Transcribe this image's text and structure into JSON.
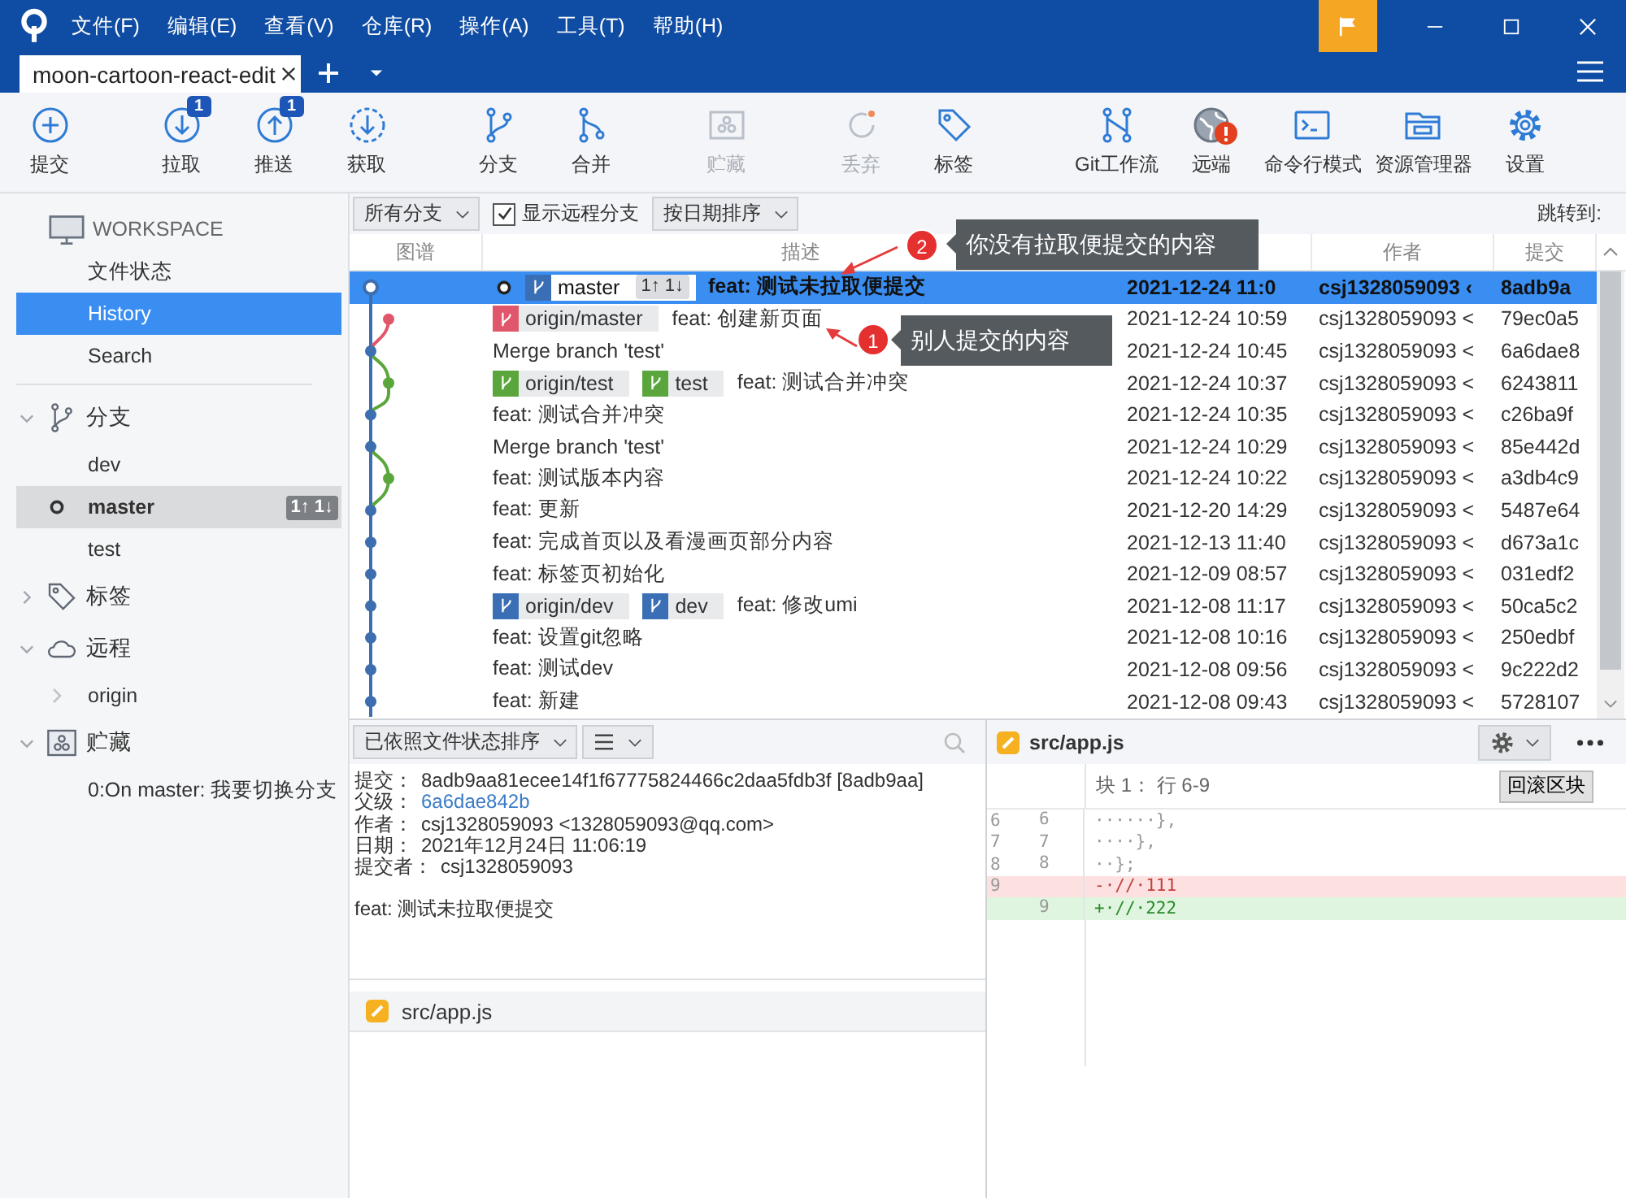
{
  "title_bar": {
    "menus": [
      "文件(F)",
      "编辑(E)",
      "查看(V)",
      "仓库(R)",
      "操作(A)",
      "工具(T)",
      "帮助(H)"
    ]
  },
  "tabs": [
    {
      "label": "moon-cartoon-react-edit",
      "selected": true
    }
  ],
  "toolbar": {
    "groups": [
      [
        {
          "label": "提交",
          "kind": "commit",
          "disabled": false
        }
      ],
      [
        {
          "label": "拉取",
          "kind": "pull",
          "disabled": false,
          "badge": "1"
        },
        {
          "label": "推送",
          "kind": "push",
          "disabled": false,
          "badge": "1"
        },
        {
          "label": "获取",
          "kind": "fetch",
          "disabled": false
        }
      ],
      [
        {
          "label": "分支",
          "kind": "branch",
          "disabled": false
        },
        {
          "label": "合并",
          "kind": "merge",
          "disabled": false
        }
      ],
      [
        {
          "label": "贮藏",
          "kind": "stash",
          "disabled": true
        }
      ],
      [
        {
          "label": "丢弃",
          "kind": "discard",
          "disabled": true
        },
        {
          "label": "标签",
          "kind": "tag",
          "disabled": false
        }
      ],
      [
        {
          "label": "Git工作流",
          "kind": "flow",
          "disabled": false
        },
        {
          "label": "远端",
          "kind": "remote",
          "disabled": false,
          "warning": true
        },
        {
          "label": "命令行模式",
          "kind": "terminal",
          "disabled": false
        },
        {
          "label": "资源管理器",
          "kind": "explorer",
          "disabled": false
        },
        {
          "label": "设置",
          "kind": "settings",
          "disabled": false
        }
      ]
    ]
  },
  "sidebar": {
    "workspace": {
      "title": "WORKSPACE",
      "items": [
        {
          "label": "文件状态",
          "selected": false
        },
        {
          "label": "History",
          "selected": true
        },
        {
          "label": "Search",
          "selected": false
        }
      ]
    },
    "sections": [
      {
        "title": "分支",
        "kind": "branches",
        "expanded": true,
        "items": [
          {
            "label": "dev",
            "current": false,
            "selected": false
          },
          {
            "label": "master",
            "current": true,
            "selected": true,
            "sync": "1↑ 1↓"
          },
          {
            "label": "test",
            "current": false,
            "selected": false
          }
        ]
      },
      {
        "title": "标签",
        "kind": "tags",
        "expanded": false
      },
      {
        "title": "远程",
        "kind": "remotes",
        "expanded": true,
        "items": [
          {
            "label": "origin",
            "expandable": true,
            "current": false,
            "selected": false
          }
        ]
      },
      {
        "title": "贮藏",
        "kind": "stashes",
        "expanded": true,
        "items": [
          {
            "label": "0:On master: 我要切换分支",
            "current": false,
            "selected": false
          }
        ]
      }
    ]
  },
  "filter_bar": {
    "branch_filter": "所有分支",
    "show_remote": {
      "label": "显示远程分支",
      "checked": true
    },
    "sort": "按日期排序",
    "jump_label": "跳转到:"
  },
  "table": {
    "columns": {
      "graph": "图谱",
      "description": "描述",
      "author": "作者",
      "commit": "提交"
    },
    "rows": [
      {
        "selected": true,
        "head": true,
        "refs": [
          {
            "label": "master",
            "color": "#3b6fb5",
            "sync": "1↑ 1↓"
          }
        ],
        "message": "feat: 测试未拉取便提交",
        "date": "2021-12-24 11:0",
        "author": "csj1328059093 ‹",
        "hash": "8adb9a"
      },
      {
        "selected": false,
        "head": false,
        "refs": [
          {
            "label": "origin/master",
            "color": "#e0566a"
          }
        ],
        "message": "feat: 创建新页面",
        "date": "2021-12-24 10:59",
        "author": "csj1328059093 <",
        "hash": "79ec0a5"
      },
      {
        "selected": false,
        "head": false,
        "message": "Merge branch 'test'",
        "date": "2021-12-24 10:45",
        "author": "csj1328059093 <",
        "hash": "6a6dae8"
      },
      {
        "selected": false,
        "head": false,
        "refs": [
          {
            "label": "origin/test",
            "color": "#5ba63c"
          },
          {
            "label": "test",
            "color": "#5ba63c"
          }
        ],
        "message": "feat: 测试合并冲突",
        "date": "2021-12-24 10:37",
        "author": "csj1328059093 <",
        "hash": "6243811"
      },
      {
        "selected": false,
        "head": false,
        "message": "feat: 测试合并冲突",
        "date": "2021-12-24 10:35",
        "author": "csj1328059093 <",
        "hash": "c26ba9f"
      },
      {
        "selected": false,
        "head": false,
        "message": "Merge branch 'test'",
        "date": "2021-12-24 10:29",
        "author": "csj1328059093 <",
        "hash": "85e442d"
      },
      {
        "selected": false,
        "head": false,
        "message": "feat: 测试版本内容",
        "date": "2021-12-24 10:22",
        "author": "csj1328059093 <",
        "hash": "a3db4c9"
      },
      {
        "selected": false,
        "head": false,
        "message": "feat: 更新",
        "date": "2021-12-20 14:29",
        "author": "csj1328059093 <",
        "hash": "5487e64"
      },
      {
        "selected": false,
        "head": false,
        "message": "feat: 完成首页以及看漫画页部分内容",
        "date": "2021-12-13 11:40",
        "author": "csj1328059093 <",
        "hash": "d673a1c"
      },
      {
        "selected": false,
        "head": false,
        "message": "feat: 标签页初始化",
        "date": "2021-12-09 08:57",
        "author": "csj1328059093 <",
        "hash": "031edf2"
      },
      {
        "selected": false,
        "head": false,
        "refs": [
          {
            "label": "origin/dev",
            "color": "#3b6fb5"
          },
          {
            "label": "dev",
            "color": "#3b6fb5"
          }
        ],
        "message": "feat: 修改umi",
        "date": "2021-12-08 11:17",
        "author": "csj1328059093 <",
        "hash": "50ca5c2"
      },
      {
        "selected": false,
        "head": false,
        "message": "feat: 设置git忽略",
        "date": "2021-12-08 10:16",
        "author": "csj1328059093 <",
        "hash": "250edbf"
      },
      {
        "selected": false,
        "head": false,
        "message": "feat: 测试dev",
        "date": "2021-12-08 09:56",
        "author": "csj1328059093 <",
        "hash": "9c222d2"
      },
      {
        "selected": false,
        "head": false,
        "message": "feat: 新建",
        "date": "2021-12-08 09:43",
        "author": "csj1328059093 <",
        "hash": "5728107"
      }
    ]
  },
  "callouts": [
    {
      "number": "2",
      "text": "你没有拉取便提交的内容"
    },
    {
      "number": "1",
      "text": "别人提交的内容"
    }
  ],
  "details": {
    "sort": "已依照文件状态排序",
    "fields": [
      {
        "label": "提交：",
        "value": "8adb9aa81ecee14f1f67775824466c2daa5fdb3f [8adb9aa]",
        "kind": "text"
      },
      {
        "label": "父级：",
        "value": "6a6dae842b",
        "kind": "link"
      },
      {
        "label": "作者：",
        "value": "csj1328059093 <1328059093@qq.com>",
        "kind": "text"
      },
      {
        "label": "日期：",
        "value": "2021年12月24日 11:06:19",
        "kind": "text"
      },
      {
        "label": "提交者：",
        "value": "csj1328059093",
        "kind": "text"
      }
    ],
    "message": "feat: 测试未拉取便提交",
    "files": [
      {
        "path": "src/app.js"
      }
    ]
  },
  "diff": {
    "file": "src/app.js",
    "hunk": "块 1： 行 6-9",
    "revert": "回滚区块",
    "lines": [
      {
        "old": "6",
        "new": "6",
        "text": "······},",
        "kind": "context"
      },
      {
        "old": "7",
        "new": "7",
        "text": "····},",
        "kind": "context"
      },
      {
        "old": "8",
        "new": "8",
        "text": "··};",
        "kind": "context"
      },
      {
        "old": "9",
        "text": "-·//·111",
        "kind": "removed"
      },
      {
        "new": "9",
        "text": "+·//·222",
        "kind": "added"
      }
    ]
  }
}
